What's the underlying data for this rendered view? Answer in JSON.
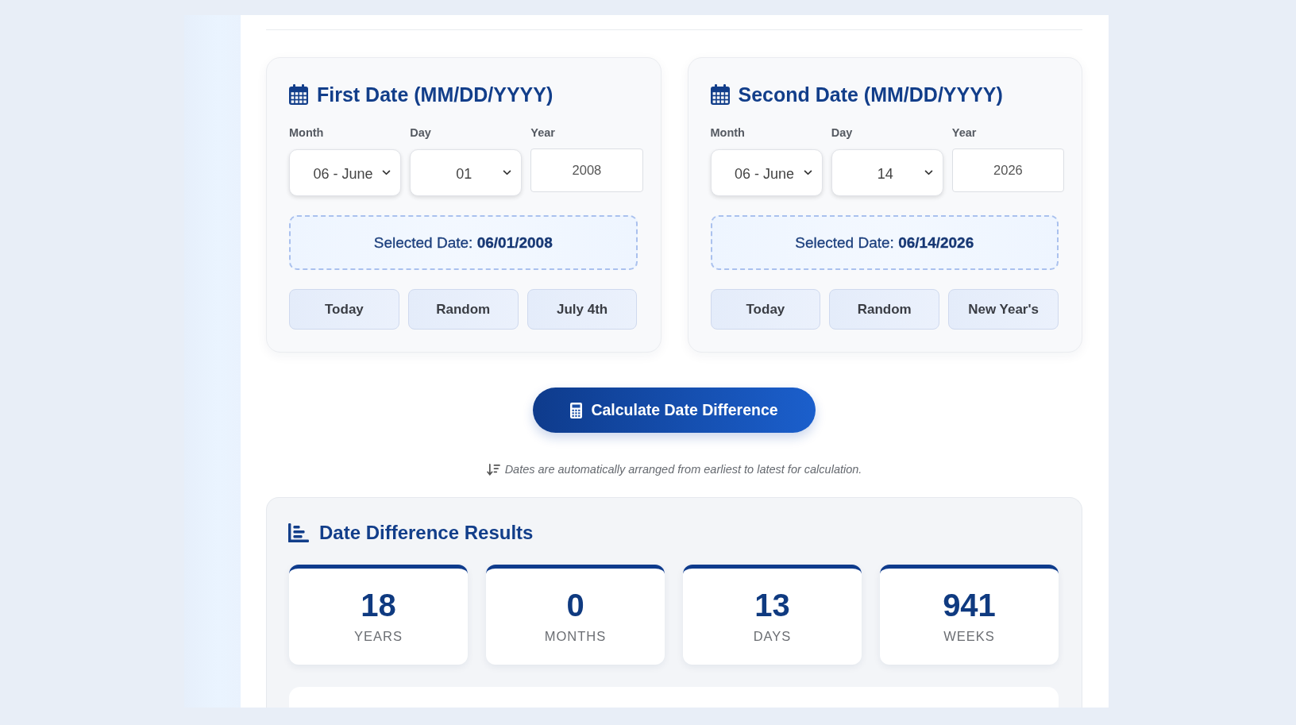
{
  "date_cards": [
    {
      "title": "First Date (MM/DD/YYYY)",
      "fields": [
        {
          "kind": "select",
          "label": "Month",
          "value": "06 - June"
        },
        {
          "kind": "select",
          "label": "Day",
          "value": "01"
        },
        {
          "kind": "input",
          "label": "Year",
          "value": "2008"
        }
      ],
      "selected_date": "Selected Date: **06/01/2008**",
      "presets": [
        "Today",
        "Random",
        "July 4th"
      ]
    },
    {
      "title": "Second Date (MM/DD/YYYY)",
      "fields": [
        {
          "kind": "select",
          "label": "Month",
          "value": "06 - June"
        },
        {
          "kind": "select",
          "label": "Day",
          "value": "14"
        },
        {
          "kind": "input",
          "label": "Year",
          "value": "2026"
        }
      ],
      "selected_date": "Selected Date: **06/14/2026**",
      "presets": [
        "Today",
        "Random",
        "New Year's"
      ]
    }
  ],
  "calculate_button": {
    "label": "Calculate Date Difference"
  },
  "note": "Dates are automatically arranged from earliest to latest for calculation.",
  "results": {
    "title": "Date Difference Results",
    "stats": [
      {
        "value": "18",
        "label": "YEARS"
      },
      {
        "value": "0",
        "label": "MONTHS"
      },
      {
        "value": "13",
        "label": "DAYS"
      },
      {
        "value": "941",
        "label": "WEEKS"
      }
    ]
  }
}
